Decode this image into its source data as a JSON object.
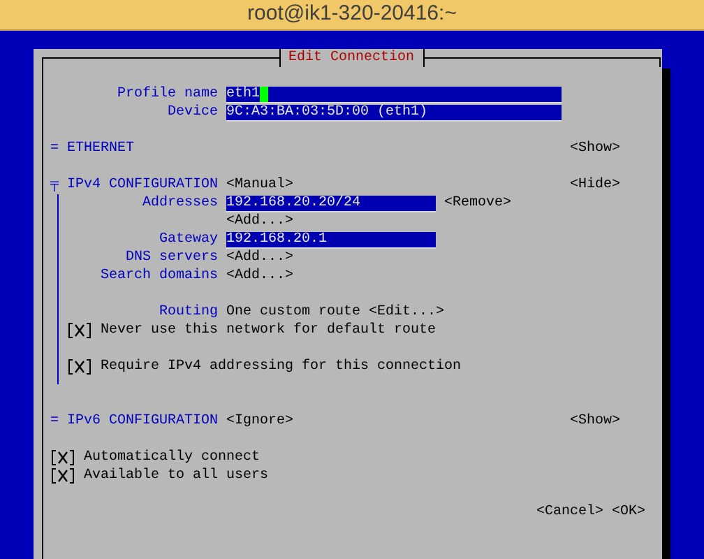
{
  "window": {
    "title": "root@ik1-320-20416:~"
  },
  "dialog": {
    "title": "Edit Connection",
    "profile_name": {
      "label": "Profile name",
      "value": "eth1",
      "focused": true
    },
    "device": {
      "label": "Device",
      "value": "9C:A3:BA:03:5D:00 (eth1)"
    },
    "ethernet": {
      "marker": "=",
      "label": "ETHERNET",
      "toggle": "<Show>"
    },
    "ipv4": {
      "marker": "╤",
      "label": "IPv4 CONFIGURATION",
      "mode": "<Manual>",
      "toggle": "<Hide>",
      "addresses": {
        "label": "Addresses",
        "values": [
          {
            "value": "192.168.20.20/24",
            "action": "<Remove>"
          }
        ],
        "add": "<Add...>"
      },
      "gateway": {
        "label": "Gateway",
        "value": "192.168.20.1"
      },
      "dns_servers": {
        "label": "DNS servers",
        "add": "<Add...>"
      },
      "search_domains": {
        "label": "Search domains",
        "add": "<Add...>"
      },
      "routing": {
        "label": "Routing",
        "value": "One custom route",
        "button": "<Edit...>"
      },
      "options": [
        {
          "label": "Never use this network for default route",
          "checked": true
        },
        {
          "label": "Require IPv4 addressing for this connection",
          "checked": true
        }
      ]
    },
    "ipv6": {
      "marker": "=",
      "label": "IPv6 CONFIGURATION",
      "mode": "<Ignore>",
      "toggle": "<Show>"
    },
    "options": [
      {
        "label": "Automatically connect",
        "checked": true
      },
      {
        "label": "Available to all users",
        "checked": true
      }
    ],
    "buttons": [
      "<Cancel>",
      "<OK>"
    ]
  }
}
